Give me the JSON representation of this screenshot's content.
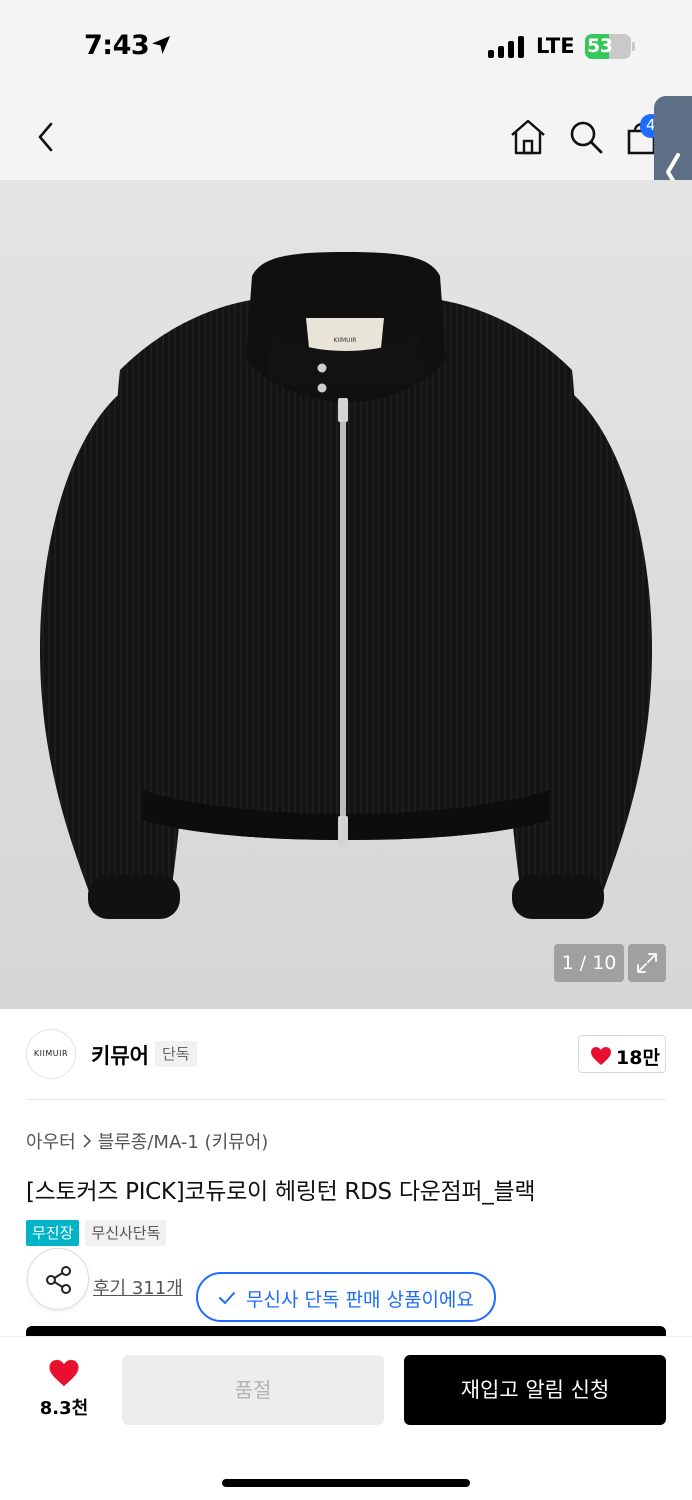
{
  "status_bar": {
    "time": "7:43",
    "network": "LTE",
    "battery_percent": "53",
    "battery_level": 0.53,
    "battery_color": "#34c759"
  },
  "nav": {
    "back_icon": "chevron-left-icon",
    "home_icon": "home-icon",
    "search_icon": "search-icon",
    "cart_icon": "shopping-bag-icon",
    "cart_badge": "4",
    "accent_color": "#1e6bff"
  },
  "gallery": {
    "counter": "1 / 10",
    "expand_icon": "expand-icon",
    "label_text": "KIIMUIR"
  },
  "brand": {
    "logo_text": "KIIMUIR",
    "name": "키뮤어",
    "tag": "단독",
    "like_count": "18만",
    "like_icon": "heart-icon"
  },
  "product": {
    "breadcrumb": [
      "아우터",
      "블루종/MA-1 (키뮤어)"
    ],
    "title": "[스토커즈 PICK]코듀로이 헤링턴 RDS 다운점퍼_블랙",
    "badges": [
      "무진장",
      "무신사단독"
    ],
    "review_link": "후기 311개",
    "exclusive_notice": "무신사 단독 판매 상품이에요",
    "badge_teal_color": "#00b4c8"
  },
  "bottom_bar": {
    "wish_count": "8.3천",
    "soldout_label": "품절",
    "restock_label": "재입고 알림 신청",
    "heart_color": "#e8102e"
  }
}
